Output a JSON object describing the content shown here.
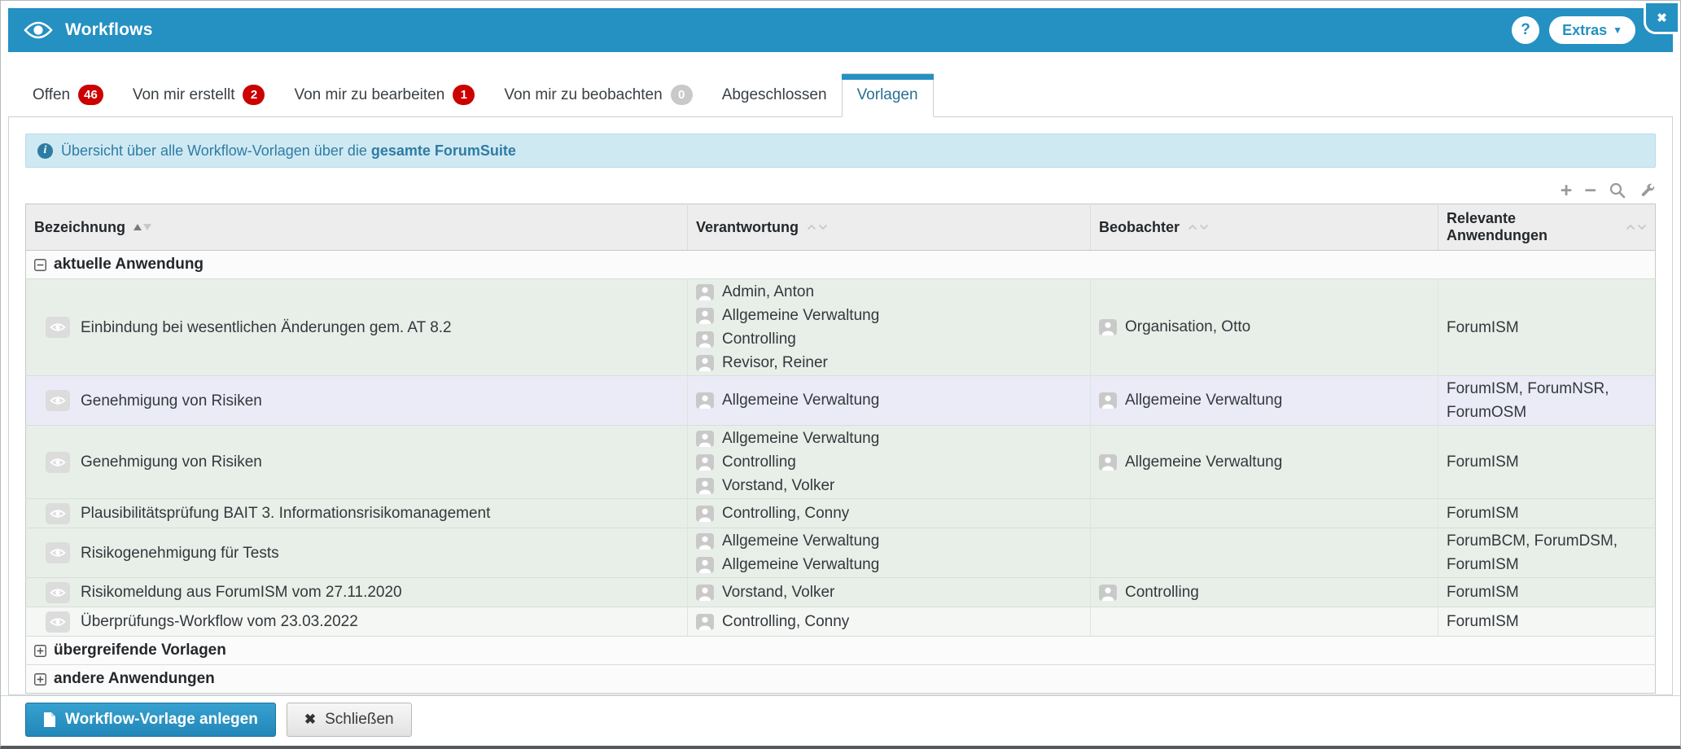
{
  "window": {
    "close_icon": "✖"
  },
  "titlebar": {
    "title": "Workflows",
    "help_label": "?",
    "extras_label": "Extras",
    "extras_caret": "▼"
  },
  "tabs": [
    {
      "label": "Offen",
      "badge": "46",
      "badge_color": "red",
      "active": false
    },
    {
      "label": "Von mir erstellt",
      "badge": "2",
      "badge_color": "red",
      "active": false
    },
    {
      "label": "Von mir zu bearbeiten",
      "badge": "1",
      "badge_color": "red",
      "active": false
    },
    {
      "label": "Von mir zu beobachten",
      "badge": "0",
      "badge_color": "gray",
      "active": false
    },
    {
      "label": "Abgeschlossen",
      "badge": null,
      "badge_color": null,
      "active": false
    },
    {
      "label": "Vorlagen",
      "badge": null,
      "badge_color": null,
      "active": true
    }
  ],
  "banner": {
    "info_icon": "i",
    "text": "Übersicht über alle Workflow-Vorlagen über die ",
    "text_bold": "gesamte ForumSuite"
  },
  "table_toolbar": {
    "plus": "+",
    "minus": "−"
  },
  "table": {
    "columns": [
      {
        "label": "Bezeichnung",
        "sort": "asc"
      },
      {
        "label": "Verantwortung",
        "sort": "none"
      },
      {
        "label": "Beobachter",
        "sort": "none"
      },
      {
        "label": "Relevante Anwendungen",
        "sort": "none"
      }
    ],
    "groups": [
      {
        "label": "aktuelle Anwendung",
        "expanded": true
      },
      {
        "label": "übergreifende Vorlagen",
        "expanded": false
      },
      {
        "label": "andere Anwendungen",
        "expanded": false
      }
    ],
    "rows": [
      {
        "name": "Einbindung bei wesentlichen Änderungen gem. AT 8.2",
        "responsible": [
          "Admin, Anton",
          "Allgemeine Verwaltung",
          "Controlling",
          "Revisor, Reiner"
        ],
        "observers": [
          "Organisation, Otto"
        ],
        "apps": "ForumISM",
        "bg": "green"
      },
      {
        "name": "Genehmigung von Risiken",
        "responsible": [
          "Allgemeine Verwaltung"
        ],
        "observers": [
          "Allgemeine Verwaltung"
        ],
        "apps": "ForumISM, ForumNSR, ForumOSM",
        "bg": "lavender"
      },
      {
        "name": "Genehmigung von Risiken",
        "responsible": [
          "Allgemeine Verwaltung",
          "Controlling",
          "Vorstand, Volker"
        ],
        "observers": [
          "Allgemeine Verwaltung"
        ],
        "apps": "ForumISM",
        "bg": "green"
      },
      {
        "name": "Plausibilitätsprüfung BAIT 3. Informationsrisikomanagement",
        "responsible": [
          "Controlling, Conny"
        ],
        "observers": [],
        "apps": "ForumISM",
        "bg": "green"
      },
      {
        "name": "Risikogenehmigung für Tests",
        "responsible": [
          "Allgemeine Verwaltung",
          "Allgemeine Verwaltung"
        ],
        "observers": [],
        "apps": "ForumBCM, ForumDSM, ForumISM",
        "bg": "green"
      },
      {
        "name": "Risikomeldung aus ForumISM vom 27.11.2020",
        "responsible": [
          "Vorstand, Volker"
        ],
        "observers": [
          "Controlling"
        ],
        "apps": "ForumISM",
        "bg": "green"
      },
      {
        "name": "Überprüfungs-Workflow vom 23.03.2022",
        "responsible": [
          "Controlling, Conny"
        ],
        "observers": [],
        "apps": "ForumISM",
        "bg": "light"
      }
    ]
  },
  "footer": {
    "create_label": "Workflow-Vorlage anlegen",
    "close_label": "Schließen",
    "close_icon": "✖"
  },
  "colors": {
    "brand": "#2590c2",
    "badge_red": "#cc0000",
    "badge_gray": "#c9c9c9",
    "banner_bg": "#cfe9f3",
    "banner_border": "#b5dcec",
    "banner_text": "#2e7ca3",
    "header_bg": "#ededed",
    "row_green": "#e8efe9",
    "row_green_light": "#f4f7f4",
    "row_lavender": "#eaebf7"
  }
}
